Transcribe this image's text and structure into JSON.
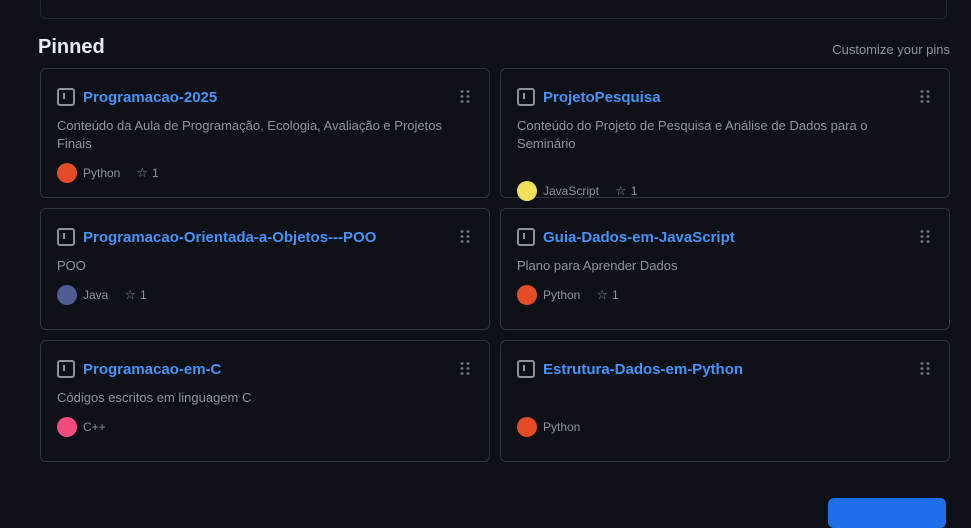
{
  "section": {
    "title": "Pinned",
    "customize_link": "Customize your pins"
  },
  "pins": [
    {
      "name": "Programacao-2025",
      "description": "Conteúdo da Aula de Programação, Ecologia, Avaliação e Projetos Finais",
      "language": "Python",
      "lang_color": "#e34c26",
      "stars": "1"
    },
    {
      "name": "ProjetoPesquisa",
      "description": "Conteúdo do Projeto de Pesquisa e Análise de Dados para o Seminário",
      "language": "JavaScript",
      "lang_color": "#f1e05a",
      "stars": "1"
    },
    {
      "name": "Programacao-Orientada-a-Objetos---POO",
      "description": "POO",
      "language": "Java",
      "lang_color": "#4f5d95",
      "stars": "1"
    },
    {
      "name": "Guia-Dados-em-JavaScript",
      "description": "Plano para Aprender Dados",
      "language": "Python",
      "lang_color": "#e34c26",
      "stars": "1"
    },
    {
      "name": "Programacao-em-C",
      "description": "Códigos escritos em linguagem C",
      "language": "C++",
      "lang_color": "#f34b7d",
      "stars": ""
    },
    {
      "name": "Estrutura-Dados-em-Python",
      "description": "",
      "language": "Python",
      "lang_color": "#e34c26",
      "stars": ""
    }
  ],
  "icons": {
    "repo": "repo-icon",
    "drag": "grabber-icon",
    "star": "star-icon"
  }
}
